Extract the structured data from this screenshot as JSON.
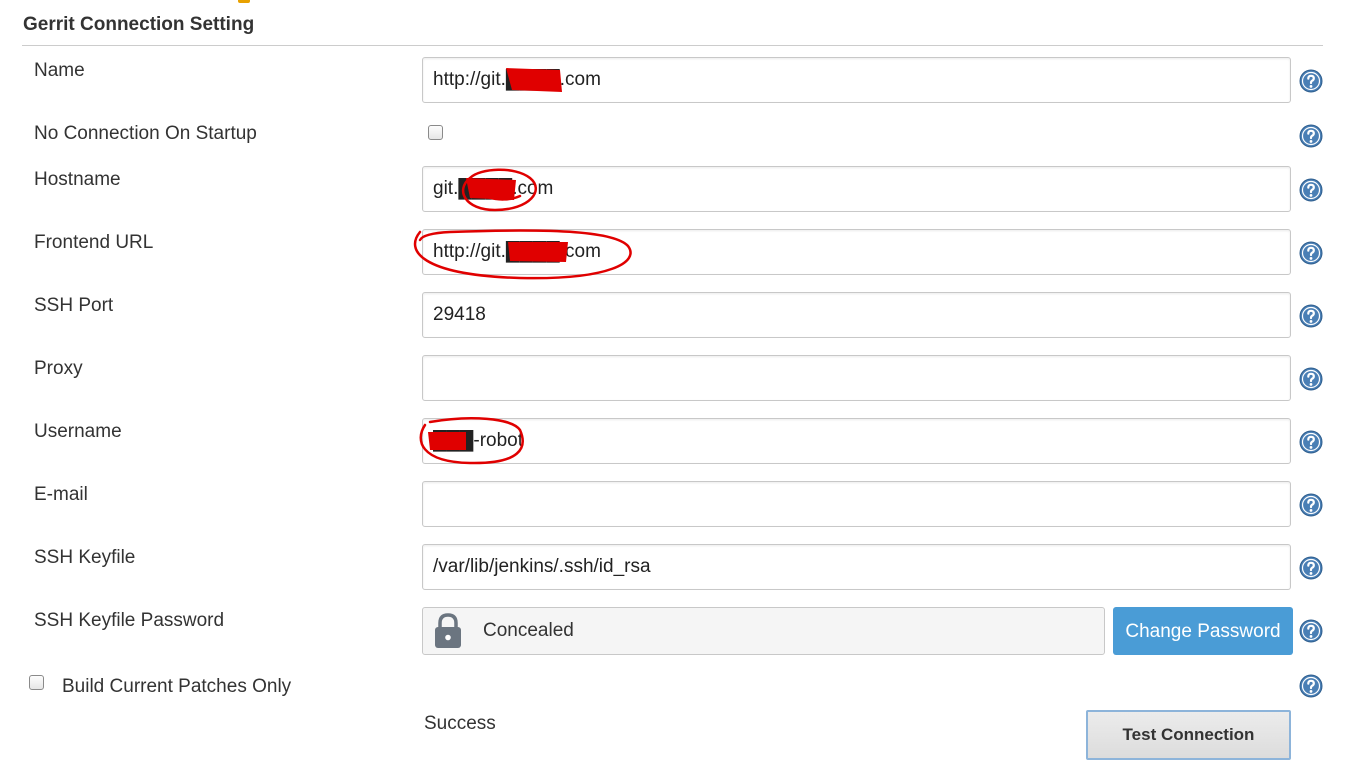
{
  "section": {
    "title": "Gerrit Connection Setting"
  },
  "fields": {
    "name": {
      "label": "Name",
      "value": "http://git.████.com"
    },
    "no_connection": {
      "label": "No Connection On Startup",
      "checked": false
    },
    "hostname": {
      "label": "Hostname",
      "value": "git.████.com"
    },
    "frontend_url": {
      "label": "Frontend URL",
      "value": "http://git.████.com"
    },
    "ssh_port": {
      "label": "SSH Port",
      "value": "29418"
    },
    "proxy": {
      "label": "Proxy",
      "value": ""
    },
    "username": {
      "label": "Username",
      "value": "███-robot"
    },
    "email": {
      "label": "E-mail",
      "value": ""
    },
    "ssh_keyfile": {
      "label": "SSH Keyfile",
      "value": "/var/lib/jenkins/.ssh/id_rsa"
    },
    "ssh_keyfile_password": {
      "label": "SSH Keyfile Password",
      "concealed_text": "Concealed",
      "change_button": "Change Password"
    },
    "build_current_patches": {
      "label": "Build Current Patches Only",
      "checked": false
    }
  },
  "test": {
    "status": "Success",
    "button": "Test Connection"
  },
  "icons": {
    "help": "help-icon",
    "lock": "lock-icon"
  },
  "colors": {
    "primary_button": "#4a9cd6",
    "annotation": "#e00000",
    "help_icon": "#4a7fb5"
  }
}
